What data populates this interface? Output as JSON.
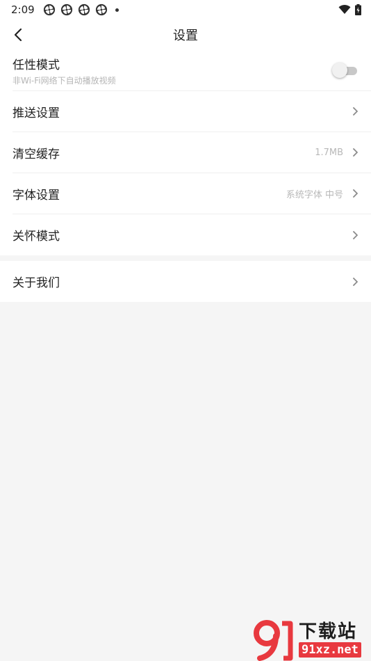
{
  "status_bar": {
    "time": "2:09",
    "notification_icons": [
      "pinwheel-icon",
      "pinwheel-icon",
      "pinwheel-icon",
      "pinwheel-icon"
    ],
    "right_icons": [
      "wifi-icon",
      "battery-icon"
    ]
  },
  "header": {
    "title": "设置",
    "back_icon": "chevron-left-icon"
  },
  "settings_group_1": [
    {
      "label": "任性模式",
      "sub": "非Wi-Fi网络下自动播放视频",
      "control": "toggle",
      "toggle_on": false
    },
    {
      "label": "推送设置",
      "value": "",
      "control": "chevron"
    },
    {
      "label": "清空缓存",
      "value": "1.7MB",
      "control": "chevron"
    },
    {
      "label": "字体设置",
      "value": "系统字体 中号",
      "control": "chevron"
    },
    {
      "label": "关怀模式",
      "value": "",
      "control": "chevron"
    }
  ],
  "settings_group_2": [
    {
      "label": "关于我们",
      "value": "",
      "control": "chevron"
    }
  ],
  "watermark": {
    "title": "下载站",
    "url": "91xz.net"
  },
  "colors": {
    "page_background": "#f5f5f5",
    "card_background": "#ffffff",
    "primary_text": "#222222",
    "secondary_text": "#b5b5b5",
    "toggle_off": "#c8c8c8",
    "watermark_red": "#e8393f"
  }
}
